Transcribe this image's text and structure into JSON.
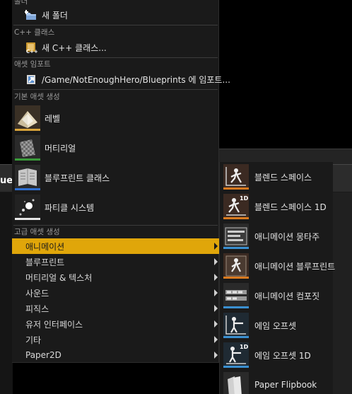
{
  "menu": {
    "folder_section": {
      "heading": "폴더",
      "new_folder": "새 폴더"
    },
    "cpp_section": {
      "heading": "C++ 클래스",
      "new_cpp": "새 C++ 클래스..."
    },
    "import_section": {
      "heading": "애셋 임포트",
      "import_to": "/Game/NotEnoughHero/Blueprints 에 임포트..."
    },
    "basic_section": {
      "heading": "기본 애셋 생성",
      "items": [
        {
          "label": "레벨",
          "icon": "level-icon",
          "accent": "#d9a43a"
        },
        {
          "label": "머티리얼",
          "icon": "material-icon",
          "accent": "#3a9a3a"
        },
        {
          "label": "블루프린트 클래스",
          "icon": "blueprint-class-icon",
          "accent": "#2f6fd0"
        },
        {
          "label": "파티클 시스템",
          "icon": "particle-system-icon",
          "accent": "#e8e8e8"
        }
      ]
    },
    "advanced_section": {
      "heading": "고급 애셋 생성",
      "items": [
        {
          "label": "애니메이션",
          "active": true
        },
        {
          "label": "블루프린트"
        },
        {
          "label": "머티리얼 & 텍스처"
        },
        {
          "label": "사운드"
        },
        {
          "label": "피직스"
        },
        {
          "label": "유저 인터페이스"
        },
        {
          "label": "기타"
        },
        {
          "label": "Paper2D"
        }
      ]
    }
  },
  "submenu": {
    "items": [
      {
        "label": "블렌드 스페이스",
        "icon": "blend-space-icon",
        "accent": "#d97a20"
      },
      {
        "label": "블렌드 스페이스 1D",
        "icon": "blend-space-1d-icon",
        "accent": "#d97a20",
        "badge": "1D"
      },
      {
        "label": "애니메이션 몽타주",
        "icon": "anim-montage-icon",
        "accent": "#3a8fd0"
      },
      {
        "label": "애니메이션 블루프린트",
        "icon": "anim-blueprint-icon",
        "accent": "#d97a20"
      },
      {
        "label": "애니메이션 컴포짓",
        "icon": "anim-composite-icon",
        "accent": "#3a8fd0"
      },
      {
        "label": "에임 오프셋",
        "icon": "aim-offset-icon",
        "accent": "#3a8fd0"
      },
      {
        "label": "에임 오프셋 1D",
        "icon": "aim-offset-1d-icon",
        "accent": "#3a8fd0",
        "badge": "1D"
      },
      {
        "label": "Paper Flipbook",
        "icon": "paper-flipbook-icon",
        "accent": "#3a8fd0"
      }
    ]
  },
  "background": {
    "left_tab_text": "uep"
  }
}
